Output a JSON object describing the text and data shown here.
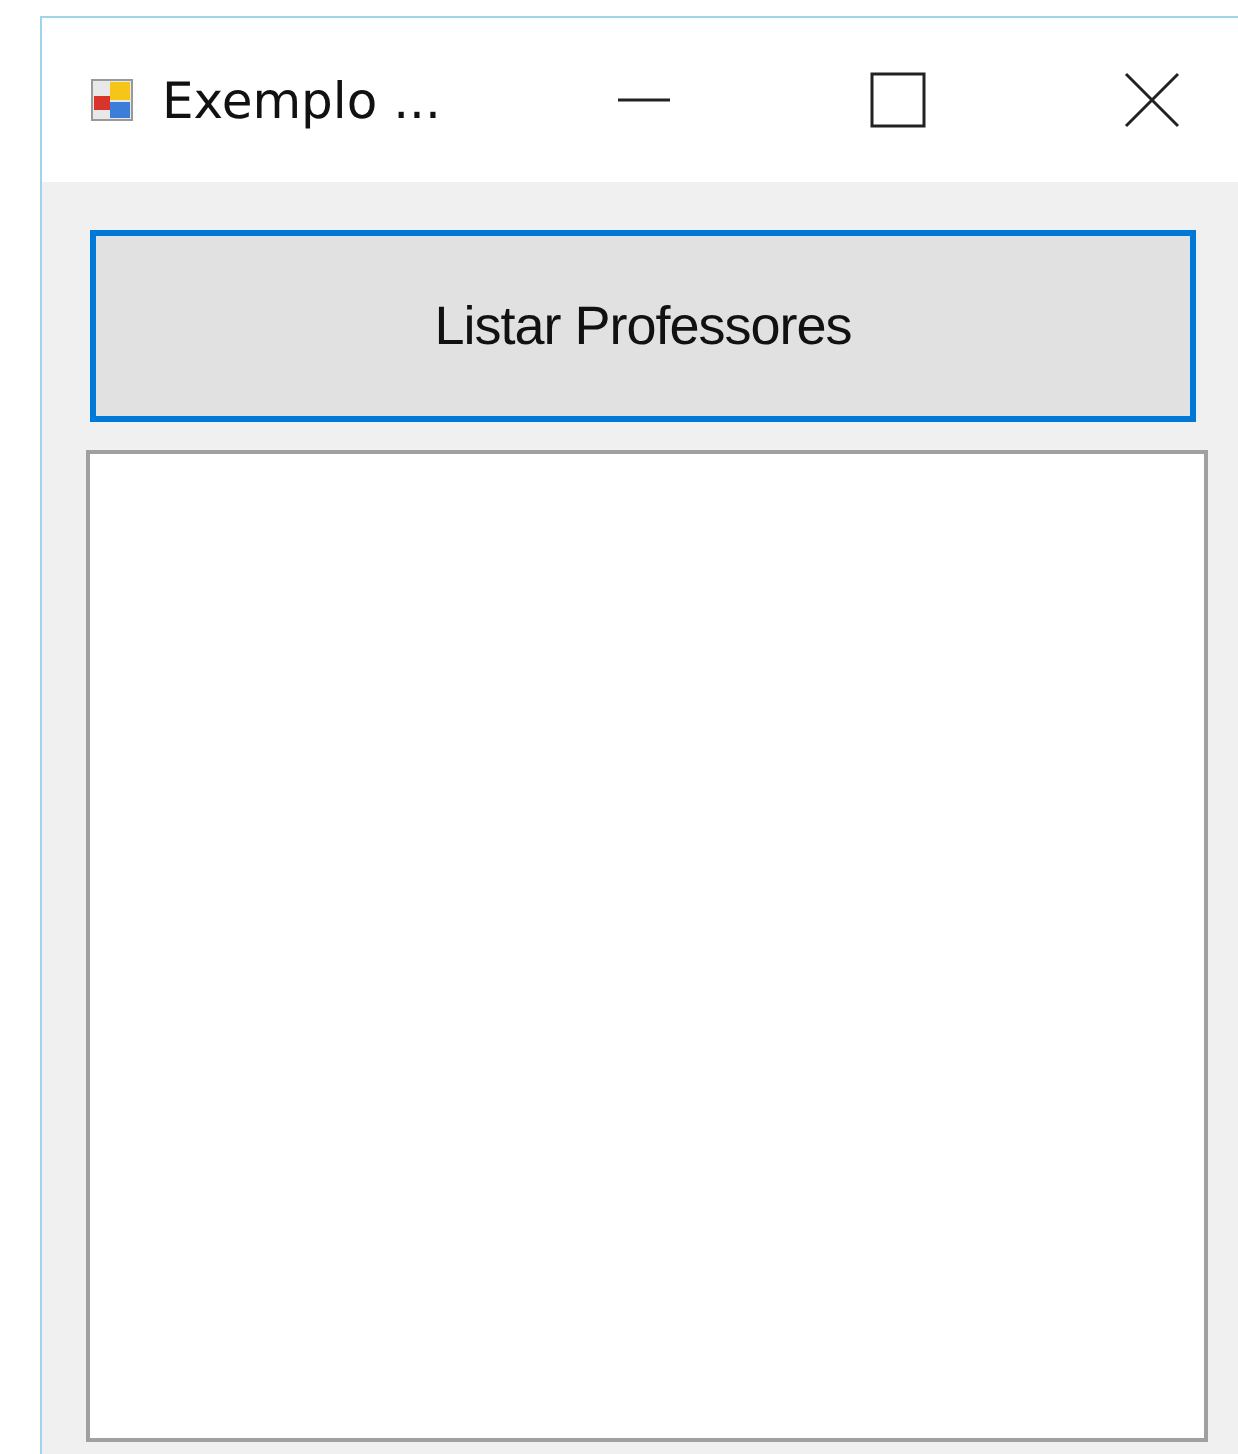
{
  "window": {
    "title": "Exemplo ..."
  },
  "button": {
    "label": "Listar Professores",
    "focused": true
  }
}
